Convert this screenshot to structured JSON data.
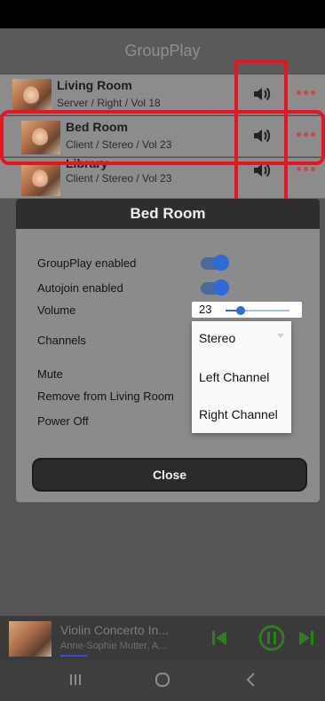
{
  "app": {
    "title": "GroupPlay"
  },
  "rooms": [
    {
      "name": "Living Room",
      "detail": "Server / Right / Vol 18"
    },
    {
      "name": "Bed Room",
      "detail": "Client / Stereo / Vol 23"
    },
    {
      "name": "Library",
      "detail": "Client / Stereo / Vol 23"
    }
  ],
  "dialog": {
    "title": "Bed Room",
    "groupplay_label": "GroupPlay enabled",
    "groupplay_enabled": true,
    "autojoin_label": "Autojoin enabled",
    "autojoin_enabled": true,
    "volume_label": "Volume",
    "volume_value": "23",
    "volume_level_percent": 23,
    "channels_label": "Channels",
    "channels_selected": "Stereo",
    "channels_options": [
      "Stereo",
      "Left Channel",
      "Right Channel"
    ],
    "mute_label": "Mute",
    "remove_label": "Remove from Living Room",
    "poweroff_label": "Power Off",
    "close_label": "Close"
  },
  "player": {
    "title": "Violin Concerto In...",
    "artist": "Anne-Sophie Mutter, A..."
  },
  "colors": {
    "highlight": "#e8141e",
    "accent": "#2f6bd6",
    "player_controls": "#2e7d1e",
    "more_dots": "#c64a4a"
  },
  "icons": [
    "volume-icon",
    "more-icon",
    "skip-previous-icon",
    "pause-icon",
    "skip-next-icon",
    "recent-apps-icon",
    "home-icon",
    "back-icon"
  ]
}
